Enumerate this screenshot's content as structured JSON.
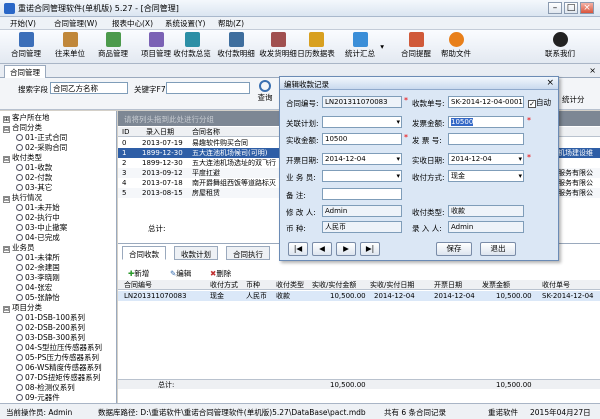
{
  "window": {
    "title": "重诺合同管理软件(单机版) 5.27 - [合同管理]"
  },
  "menu": [
    "开始(V)",
    "合同管理(W)",
    "报表中心(X)",
    "系统设置(Y)",
    "帮助(Z)"
  ],
  "toolbar": [
    "合同管理",
    "往来单位",
    "商品管理",
    "项目管理",
    "收付款总览",
    "收付款明细",
    "收发货明细",
    "日历数据表",
    "统计汇总",
    "合同提醒",
    "帮助文件",
    "联系我们"
  ],
  "tab": {
    "label": "合同管理"
  },
  "search": {
    "field_label": "搜索字段",
    "field_value": "合同乙方名称",
    "keyword_label": "关键字F7",
    "keyword_value": "",
    "query_button": "查询",
    "stats_label": "统计分"
  },
  "tree": [
    {
      "label": "客户所在地",
      "level": 0,
      "expander": "⊞"
    },
    {
      "label": "合同分类",
      "level": 0,
      "expander": "⊟"
    },
    {
      "label": "01-正式合同",
      "level": 1
    },
    {
      "label": "02-采购合同",
      "level": 1
    },
    {
      "label": "收付类型",
      "level": 0,
      "expander": "⊟"
    },
    {
      "label": "01-收款",
      "level": 1
    },
    {
      "label": "02-付款",
      "level": 1
    },
    {
      "label": "03-其它",
      "level": 1
    },
    {
      "label": "执行情况",
      "level": 0,
      "expander": "⊟"
    },
    {
      "label": "01-未开始",
      "level": 1
    },
    {
      "label": "02-执行中",
      "level": 1
    },
    {
      "label": "03-中止撤案",
      "level": 1
    },
    {
      "label": "04-已完成",
      "level": 1
    },
    {
      "label": "业务员",
      "level": 0,
      "expander": "⊟"
    },
    {
      "label": "01-未律所",
      "level": 1
    },
    {
      "label": "02-余建国",
      "level": 1
    },
    {
      "label": "03-李晓刚",
      "level": 1
    },
    {
      "label": "04-张宏",
      "level": 1
    },
    {
      "label": "05-张静怡",
      "level": 1
    },
    {
      "label": "项目分类",
      "level": 0,
      "expander": "⊟"
    },
    {
      "label": "01-DSB-100系列",
      "level": 1
    },
    {
      "label": "02-DSB-200系列",
      "level": 1
    },
    {
      "label": "03-DSB-300系列",
      "level": 1
    },
    {
      "label": "04-S型拉压传感器系列",
      "level": 1
    },
    {
      "label": "05-PS压力传感器系列",
      "level": 1
    },
    {
      "label": "06-WS精度传感器系列",
      "level": 1
    },
    {
      "label": "07-DS扭矩传感器系列",
      "level": 1
    },
    {
      "label": "08-检测仪系列",
      "level": 1
    },
    {
      "label": "09-元器件",
      "level": 1
    }
  ],
  "grid": {
    "hint": "请将列头拖到此处进行分组",
    "headers": [
      "ID",
      "录入日期",
      "合同名称"
    ],
    "rows": [
      {
        "id": "0",
        "date": "2013-07-19",
        "name": "易趣软件购买合同",
        "extra": ""
      },
      {
        "id": "1",
        "date": "1899-12-30",
        "name": "五大连池机场候司(可明)",
        "extra": "机场建设维"
      },
      {
        "id": "2",
        "date": "1899-12-30",
        "name": "五大连池机场选址的双飞行",
        "extra": ""
      },
      {
        "id": "3",
        "date": "2013-09-12",
        "name": "平度扛避",
        "extra": "服务有限公"
      },
      {
        "id": "4",
        "date": "2013-07-18",
        "name": "南开爵舞组西饭等道路标灭",
        "extra": "服务有限公"
      },
      {
        "id": "5",
        "date": "2013-08-15",
        "name": "房屋租赁",
        "extra": "服务有限公"
      }
    ],
    "footer_label": "总计:"
  },
  "bottom": {
    "tabs": [
      "合同收款",
      "收款计划",
      "合同执行"
    ],
    "actions": [
      "新增",
      "编辑",
      "删除"
    ],
    "headers": [
      "合同编号",
      "收付方式",
      "币种",
      "收付类型",
      "实收/实付金额",
      "实收/实付日期",
      "开票日期",
      "发票金额",
      "收付单号"
    ],
    "row": [
      "LN201311070083",
      "现金",
      "人民币",
      "收款",
      "10,500.00",
      "2014-12-04",
      "2014-12-04",
      "10,500.00",
      "SK-2014-12-04"
    ],
    "footer": {
      "label": "总计:",
      "amount": "10,500.00",
      "invoice": "10,500.00"
    }
  },
  "dialog": {
    "title": "编辑收款记录",
    "contract_no_label": "合同编号:",
    "contract_no": "LN201311070083",
    "receipt_no_label": "收款单号:",
    "receipt_no": "SK-2014-12-04-0001",
    "auto_label": "自动",
    "related_plan_label": "关联计划:",
    "related_plan": "",
    "invoice_amount_label": "发票金额:",
    "invoice_amount": "10500",
    "actual_amount_label": "实收金额:",
    "actual_amount": "10500",
    "invoice_no_label": "发 票 号:",
    "invoice_no": "",
    "invoice_date_label": "开票日期:",
    "invoice_date": "2014-12-04",
    "receipt_date_label": "实收日期:",
    "receipt_date": "2014-12-04",
    "salesman_label": "业 务 员:",
    "salesman": "",
    "pay_method_label": "收付方式:",
    "pay_method": "现金",
    "remark_label": "备    注:",
    "remark": "",
    "modifier_label": "修 改 人:",
    "modifier": "Admin",
    "type_label": "收付类型:",
    "type": "收款",
    "currency_label": "币    种:",
    "currency": "人民币",
    "recorder_label": "录 入 人:",
    "recorder": "Admin",
    "nav": [
      "|◀",
      "◀",
      "▶",
      "▶|"
    ],
    "save": "保存",
    "exit": "退出"
  },
  "status": {
    "operator": "当前操作员: Admin",
    "db_path": "数据库路径: D:\\重诺软件\\重诺合同管理软件(单机版)5.27\\DataBase\\pact.mdb",
    "count": "共有 6 条合同记录",
    "brand": "重诺软件",
    "date": "2015年04月27日"
  }
}
